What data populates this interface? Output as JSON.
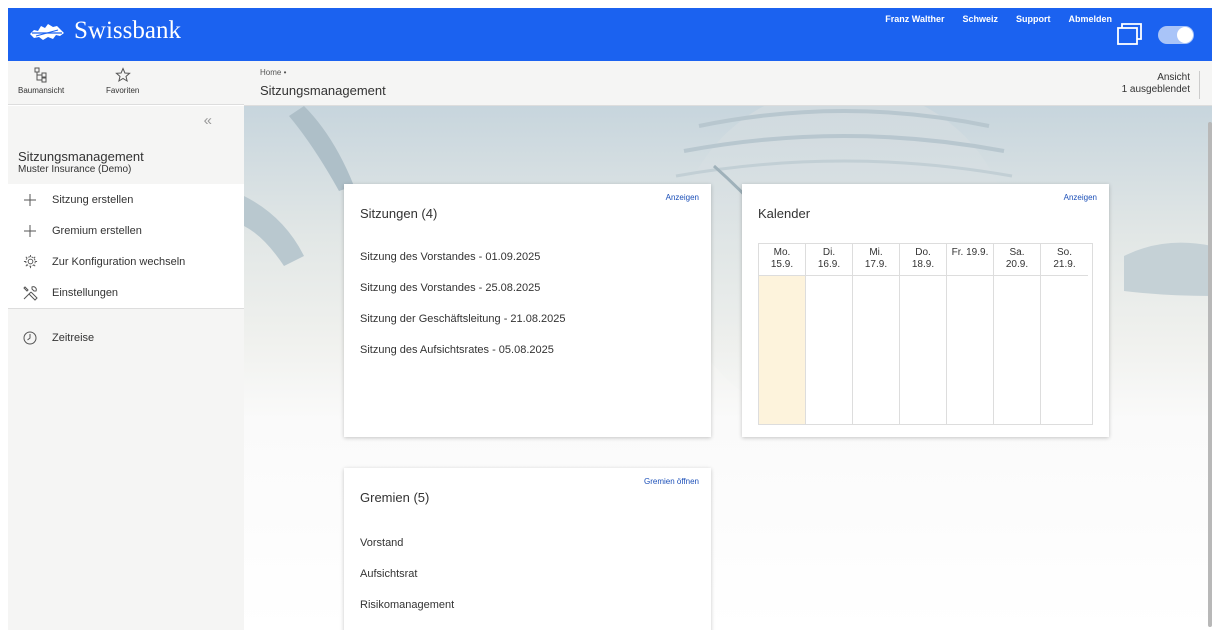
{
  "brand": {
    "name": "Swissbank"
  },
  "top_links": [
    "Franz Walther",
    "Schweiz",
    "Support",
    "Abmelden"
  ],
  "colors": {
    "topbar": "#1b62f0",
    "link": "#1b4fb8",
    "today": "#fdf3dc"
  },
  "sidebar_tools": [
    {
      "label": "Baumansicht",
      "icon": "tree-view-icon"
    },
    {
      "label": "Favoriten",
      "icon": "star-icon"
    }
  ],
  "sidebar": {
    "title": "Sitzungsmanagement",
    "subtitle": "Muster Insurance (Demo)",
    "items": [
      {
        "label": "Sitzung erstellen",
        "icon": "plus-icon"
      },
      {
        "label": "Gremium erstellen",
        "icon": "plus-icon"
      },
      {
        "label": "Zur Konfiguration wechseln",
        "icon": "gear-icon"
      },
      {
        "label": "Einstellungen",
        "icon": "tools-icon"
      }
    ],
    "secondary": [
      {
        "label": "Zeitreise",
        "icon": "clock-icon"
      }
    ]
  },
  "header": {
    "breadcrumb": "Home •",
    "title": "Sitzungsmanagement",
    "view_label": "Ansicht",
    "view_sub": "1 ausgeblendet"
  },
  "sessions_card": {
    "title": "Sitzungen (4)",
    "action": "Anzeigen",
    "items": [
      "Sitzung des Vorstandes - 01.09.2025",
      "Sitzung des Vorstandes - 25.08.2025",
      "Sitzung der Geschäftsleitung - 21.08.2025",
      "Sitzung des Aufsichtsrates - 05.08.2025"
    ]
  },
  "calendar_card": {
    "title": "Kalender",
    "action": "Anzeigen",
    "days": [
      {
        "label": "Mo.\n15.9.",
        "today": true
      },
      {
        "label": "Di.\n16.9.",
        "today": false
      },
      {
        "label": "Mi.\n17.9.",
        "today": false
      },
      {
        "label": "Do.\n18.9.",
        "today": false
      },
      {
        "label": "Fr. 19.9.",
        "today": false
      },
      {
        "label": "Sa.\n20.9.",
        "today": false
      },
      {
        "label": "So.\n21.9.",
        "today": false
      }
    ]
  },
  "committees_card": {
    "title": "Gremien (5)",
    "action": "Gremien öffnen",
    "items": [
      "Vorstand",
      "Aufsichtsrat",
      "Risikomanagement"
    ]
  }
}
